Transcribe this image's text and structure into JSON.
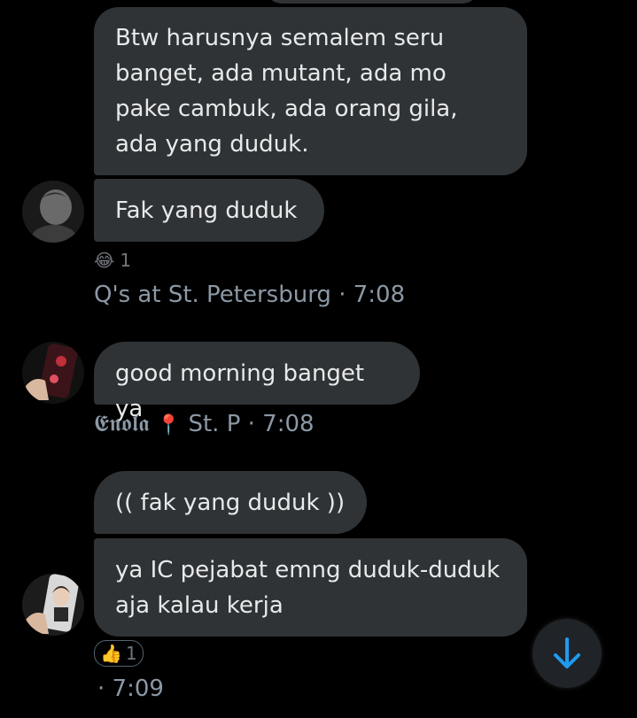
{
  "messages": [
    {
      "text": "Btw harusnya semalem seru banget, ada mutant, ada mo pake cambuk, ada orang gila, ada yang duduk."
    },
    {
      "text": "Fak yang duduk"
    },
    {
      "text": "good morning banget ya"
    },
    {
      "text": "(( fak yang duduk ))"
    },
    {
      "text": "ya IC pejabat emng duduk-duduk aja kalau kerja"
    }
  ],
  "reactions": [
    {
      "emoji": "😂",
      "count": "1"
    },
    {
      "emoji": "👍",
      "count": "1"
    }
  ],
  "meta": [
    {
      "sender": "Q's at St. Petersburg",
      "time": "· 7:08"
    },
    {
      "sender": "𝕰𝖓𝖔𝖑𝖆",
      "pin": "📍",
      "location": "St. P",
      "time": "· 7:08"
    },
    {
      "time": "· 7:09"
    }
  ],
  "icons": {
    "scroll_down": "arrow-down-icon"
  },
  "colors": {
    "bubble": "#2f3336",
    "accent": "#1d9bf0",
    "meta": "#8b98a5"
  }
}
